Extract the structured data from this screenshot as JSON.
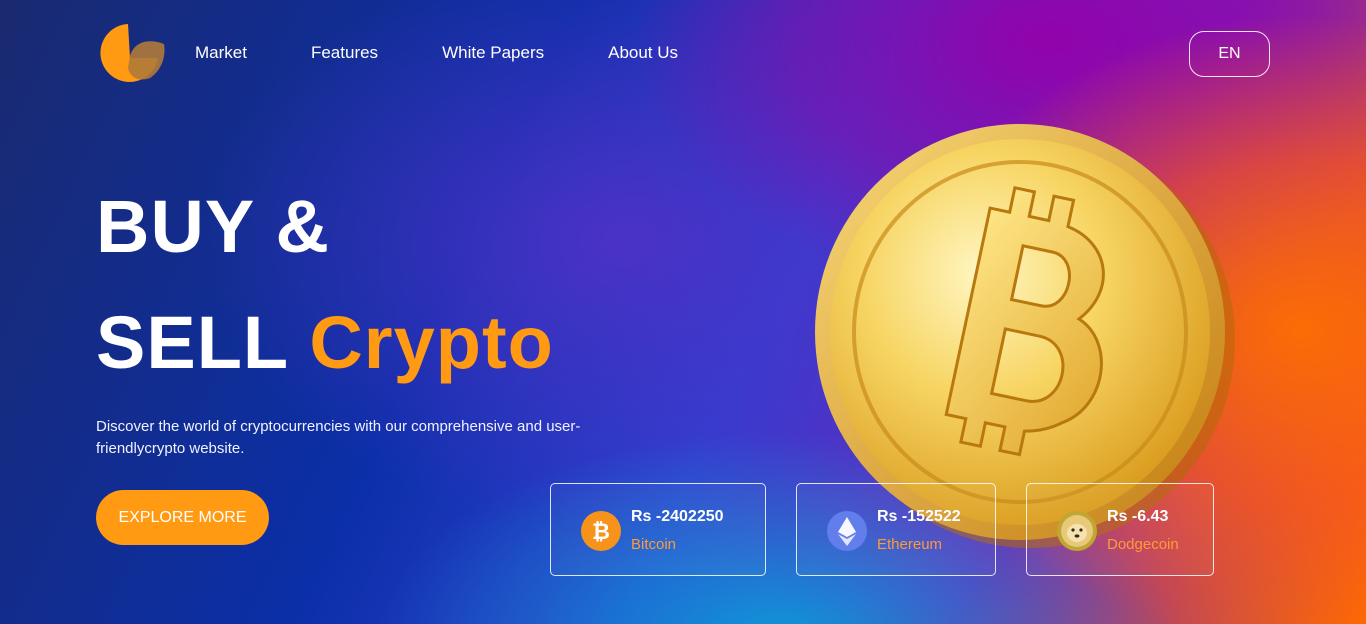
{
  "header": {
    "nav": [
      "Market",
      "Features",
      "White Papers",
      "About Us"
    ],
    "language": "EN"
  },
  "hero": {
    "line1": "BUY &",
    "line2_white": "SELL",
    "line2_accent": "Crypto",
    "description": "Discover the world of cryptocurrencies with our comprehensive and user-friendlycrypto website.",
    "cta": "EXPLORE MORE"
  },
  "prices": [
    {
      "price": "Rs -2402250",
      "name": "Bitcoin",
      "icon": "bitcoin-icon"
    },
    {
      "price": "Rs -152522",
      "name": "Ethereum",
      "icon": "ethereum-icon"
    },
    {
      "price": "Rs -6.43",
      "name": "Dodgecoin",
      "icon": "dogecoin-icon"
    }
  ],
  "colors": {
    "accent": "#ff9a12",
    "price_label": "#ff9a3a",
    "coin_gold": "#f5c440"
  }
}
